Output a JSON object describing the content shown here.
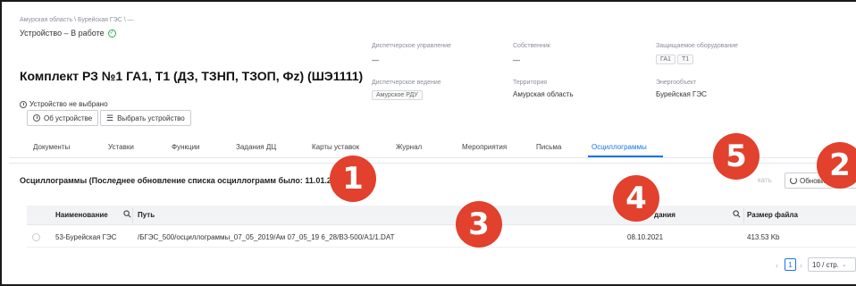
{
  "breadcrumb": "Амурская область \\ Бурейская ГЭС \\ —",
  "device_status": "Устройство – В работе",
  "title": "Комплект РЗ №1 ГА1, Т1 (ДЗ, ТЗНП, ТЗОП, Фz) (ШЭ1111)",
  "not_selected": "Устройство не выбрано",
  "buttons": {
    "about": "Об устройстве",
    "choose": "Выбрать устройство"
  },
  "meta": {
    "dispatch_label": "Диспетчерское управление",
    "dispatch_value": "—",
    "owner_label": "Собственник",
    "owner_value": "—",
    "protected_label": "Защищаемое оборудование",
    "protected_tags": [
      "ГА1",
      "Т1"
    ],
    "dispatch_mgmt_label": "Диспетчерское ведение",
    "dispatch_mgmt_value": "Амурское РДУ",
    "territory_label": "Территория",
    "territory_value": "Амурская область",
    "energy_label": "Энергообъект",
    "energy_value": "Бурейская ГЭС"
  },
  "tabs": [
    "Документы",
    "Уставки",
    "Функции",
    "Задания ДЦ",
    "Карты уставок",
    "Журнал",
    "Мероприятия",
    "Письма",
    "Осциллограммы"
  ],
  "active_tab": "Осциллограммы",
  "section": {
    "title": "Осциллограммы (Последнее обновление списка осциллограмм было: 11.01.2022 1",
    "faded_btn": "кать",
    "refresh_label": "Обновить"
  },
  "table": {
    "headers": {
      "name": "Наименование",
      "path": "Путь",
      "date": "дания",
      "size": "Размер файла"
    },
    "rows": [
      {
        "name": "53-Бурейская ГЭС",
        "path": "/БГЭС_500/осциллограммы_07_05_2019/Ам 07_05_19 6_28/В3-500/А1/1.DAT",
        "date": "08.10.2021",
        "size": "413.53 Kb"
      }
    ]
  },
  "pagination": {
    "current": "1",
    "page_size": "10 / стр."
  },
  "badges": [
    "1",
    "3",
    "4",
    "5",
    "2"
  ],
  "colors": {
    "accent": "#1a73e8",
    "badge": "#e1412d",
    "ok": "#3aa757"
  }
}
